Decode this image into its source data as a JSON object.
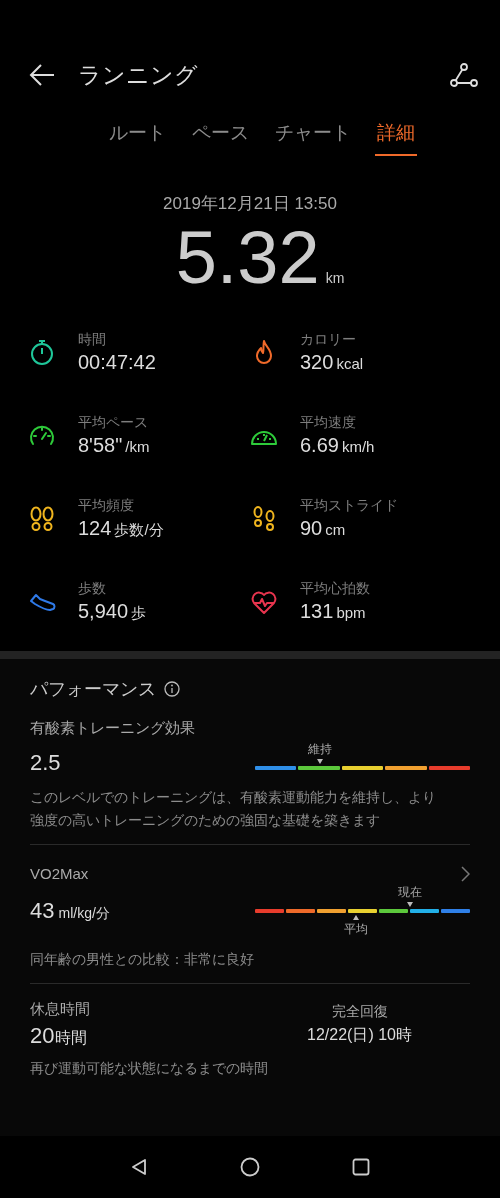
{
  "header": {
    "title": "ランニング"
  },
  "tabs": [
    {
      "label": "ルート",
      "selected": false
    },
    {
      "label": "ペース",
      "selected": false
    },
    {
      "label": "チャート",
      "selected": false
    },
    {
      "label": "詳細",
      "selected": true
    }
  ],
  "summary": {
    "date": "2019年12月21日 13:50",
    "distance": "5.32",
    "unit": "km"
  },
  "stats": [
    {
      "kind": "stopwatch",
      "color": "#1fc79a",
      "label": "時間",
      "value": "00:47:42"
    },
    {
      "kind": "flame",
      "color": "#f06a2a",
      "label": "カロリー",
      "value": "320",
      "unit": "kcal"
    },
    {
      "kind": "gauge",
      "color": "#2ecb3a",
      "label": "平均ペース",
      "value": "8'58\"",
      "unit": "/km"
    },
    {
      "kind": "speedometer",
      "color": "#2ecb3a",
      "label": "平均速度",
      "value": "6.69",
      "unit": "km/h"
    },
    {
      "kind": "footprints",
      "color": "#f0b51e",
      "label": "平均頻度",
      "value": "124",
      "unit": "歩数/分"
    },
    {
      "kind": "footsteps",
      "color": "#f0b51e",
      "label": "平均ストライド",
      "value": "90",
      "unit": "cm"
    },
    {
      "kind": "shoe",
      "color": "#2f7ae8",
      "label": "歩数",
      "value": "5,940",
      "unit": "歩"
    },
    {
      "kind": "heart",
      "color": "#e8344e",
      "label": "平均心拍数",
      "value": "131",
      "unit": "bpm"
    }
  ],
  "performance": {
    "title": "パフォーマンス",
    "aerobic": {
      "title": "有酸素トレーニング効果",
      "value": "2.5",
      "segments": [
        {
          "color": "#2f8fe8"
        },
        {
          "color": "#5cc83c"
        },
        {
          "color": "#e8d030"
        },
        {
          "color": "#f0a030"
        },
        {
          "color": "#e83c2c"
        }
      ],
      "markers": [
        {
          "kind": "above",
          "label": "維持"
        }
      ],
      "description": "このレベルでのトレーニングは、有酸素運動能力を維持し、より強度の高いトレーニングのための強固な基礎を築きます"
    },
    "vo2max": {
      "title": "VO2Max",
      "value": "43",
      "unit": "ml/kg/分",
      "segments": [
        {
          "color": "#e83c2c"
        },
        {
          "color": "#ee6a2a"
        },
        {
          "color": "#f0a030"
        },
        {
          "color": "#e8d030"
        },
        {
          "color": "#5cc83c"
        },
        {
          "color": "#22b0e8"
        },
        {
          "color": "#2f80e8"
        }
      ],
      "markers": [
        {
          "kind": "above",
          "label": "現在"
        },
        {
          "kind": "below",
          "label": "平均"
        }
      ],
      "comparison": "同年齢の男性との比較：非常に良好"
    },
    "recovery": {
      "title": "休息時間",
      "value": "20",
      "unit": "時間",
      "label": "完全回復",
      "time": "12/22(日) 10時",
      "description": "再び運動可能な状態になるまでの時間"
    }
  }
}
